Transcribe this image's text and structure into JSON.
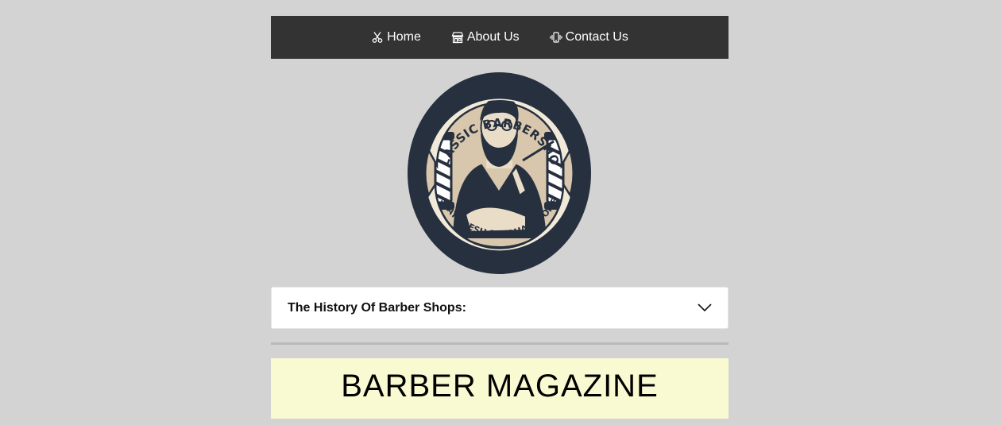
{
  "nav": {
    "items": [
      {
        "label": "Home",
        "icon": "scissors-icon"
      },
      {
        "label": "About Us",
        "icon": "storefront-icon"
      },
      {
        "label": "Contact Us",
        "icon": "phone-vibrate-icon"
      }
    ]
  },
  "logo": {
    "top_text": "CLASSIC BARBERSHOP",
    "bottom_text": "STAY FRESH STAY HANDSOME"
  },
  "accordion": {
    "title": "The History Of Barber Shops:"
  },
  "banner": {
    "title": "BARBER MAGAZINE"
  },
  "colors": {
    "page_background": "#d3d3d3",
    "nav_background": "#333333",
    "banner_background": "#fafad2",
    "logo_navy": "#27303f",
    "logo_tan": "#d8c7ac"
  }
}
